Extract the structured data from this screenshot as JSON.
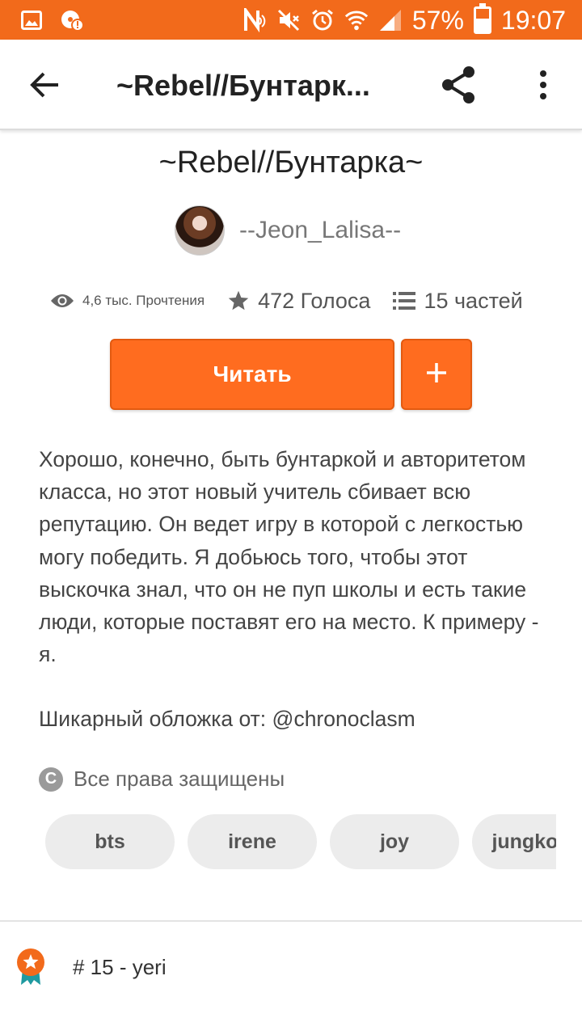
{
  "status_bar": {
    "battery_percent": "57%",
    "time": "19:07",
    "battery_level": 0.57,
    "color": "#f26a1b"
  },
  "app_bar": {
    "title": "~Rebel//Бунтарк..."
  },
  "story": {
    "title": "~Rebel//Бунтарка~",
    "author": "--Jeon_Lalisa--",
    "reads": "4,6 тыс. Прочтения",
    "votes": "472 Голоса",
    "parts": "15 частей"
  },
  "actions": {
    "read_label": "Читать",
    "add_icon": "plus-icon",
    "accent_color": "#ff6c1f"
  },
  "description": {
    "paragraph1": "Хорошо, конечно, быть бунтаркой и авторитетом класса, но этот новый учитель сбивает всю репутацию. Он ведет игру в которой с легкостью могу победить. Я добьюсь того, чтобы этот выскочка знал, что он не пуп школы и есть такие люди, которые поставят его на место. К примеру - я.",
    "paragraph2": "Шикарный обложка от: @chronoclasm"
  },
  "copyright": {
    "label": "Все права защищены",
    "icon_glyph": "C"
  },
  "tags": [
    "bts",
    "irene",
    "joy",
    "jungkook"
  ],
  "ranking": {
    "label": "# 15 - yeri"
  }
}
